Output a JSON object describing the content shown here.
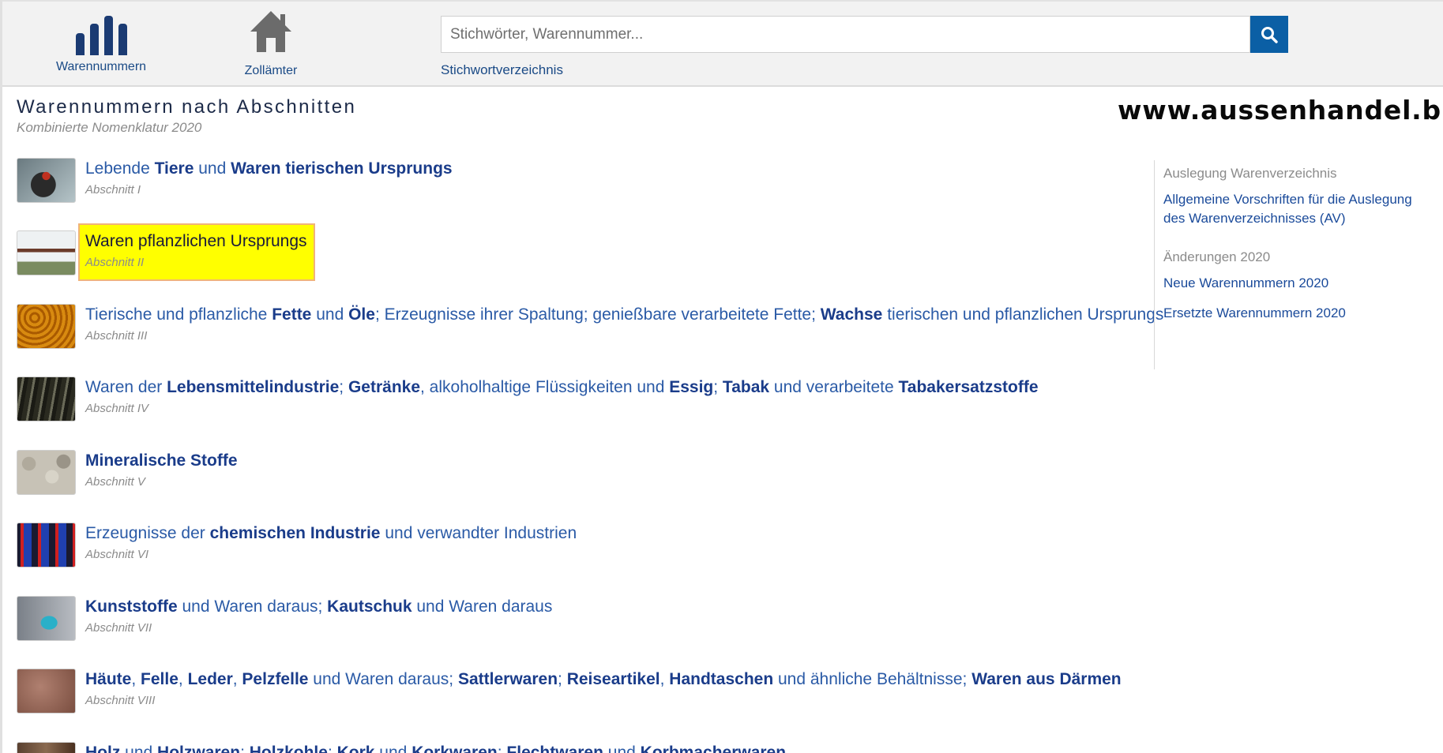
{
  "nav": {
    "warennummern_label": "Warennummern",
    "zollaemter_label": "Zollämter"
  },
  "search": {
    "placeholder": "Stichwörter, Warennummer...",
    "value": "",
    "index_link": "Stichwortverzeichnis"
  },
  "header": {
    "title": "Warennummern nach Abschnitten",
    "subtitle": "Kombinierte Nomenklatur 2020",
    "brand": "www.aussenhandel.biz"
  },
  "sections": [
    {
      "subtitle": "Abschnitt I"
    },
    {
      "title": "Waren pflanzlichen Ursprungs",
      "subtitle": "Abschnitt II"
    },
    {
      "subtitle": "Abschnitt III"
    },
    {
      "subtitle": "Abschnitt IV"
    },
    {
      "title": "Mineralische Stoffe",
      "subtitle": "Abschnitt V"
    },
    {
      "subtitle": "Abschnitt VI"
    },
    {
      "subtitle": "Abschnitt VII"
    },
    {
      "subtitle": "Abschnitt VIII"
    }
  ],
  "section_phrases": {
    "s1": [
      "Lebende ",
      "Tiere",
      " und ",
      "Waren tierischen Ursprungs"
    ],
    "s3": [
      "Tierische und pflanzliche ",
      "Fette",
      " und ",
      "Öle",
      "; Erzeugnisse ihrer Spaltung; genießbare verarbeitete Fette; ",
      "Wachse",
      " tierischen und pflanzlichen Ursprungs"
    ],
    "s4": [
      "Waren der ",
      "Lebensmittelindustrie",
      "; ",
      "Getränke",
      ", alkoholhaltige Flüssigkeiten und ",
      "Essig",
      "; ",
      "Tabak",
      " und verarbeitete ",
      "Tabakersatzstoffe"
    ],
    "s6": [
      "Erzeugnisse der ",
      "chemischen Industrie",
      " und verwandter Industrien"
    ],
    "s7": [
      "Kunststoffe",
      " und Waren daraus; ",
      "Kautschuk",
      " und Waren daraus"
    ],
    "s8": [
      "Häute",
      ", ",
      "Felle",
      ", ",
      "Leder",
      ", ",
      "Pelzfelle",
      " und Waren daraus; ",
      "Sattlerwaren",
      "; ",
      "Reiseartikel",
      ", ",
      "Handtaschen",
      " und ähnliche Behältnisse; ",
      "Waren aus Därmen"
    ],
    "s9": [
      "Holz",
      " und ",
      "Holzwaren",
      "; ",
      "Holzkohle",
      "; ",
      "Kork",
      " und ",
      "Korkwaren",
      "; ",
      "Flechtwaren",
      " und ",
      "Korbmacherwaren"
    ]
  },
  "sidebar": {
    "heading1": "Auslegung Warenverzeichnis",
    "link1": "Allgemeine Vorschriften für die Auslegung des Warenverzeichnisses (AV)",
    "heading2": "Änderungen 2020",
    "link2": "Neue Warennummern 2020",
    "link3": "Ersetzte Warennummern 2020"
  },
  "colors": {
    "accent": "#0b5fa5",
    "link": "#2a5aa6",
    "highlight": "#ffff00"
  }
}
